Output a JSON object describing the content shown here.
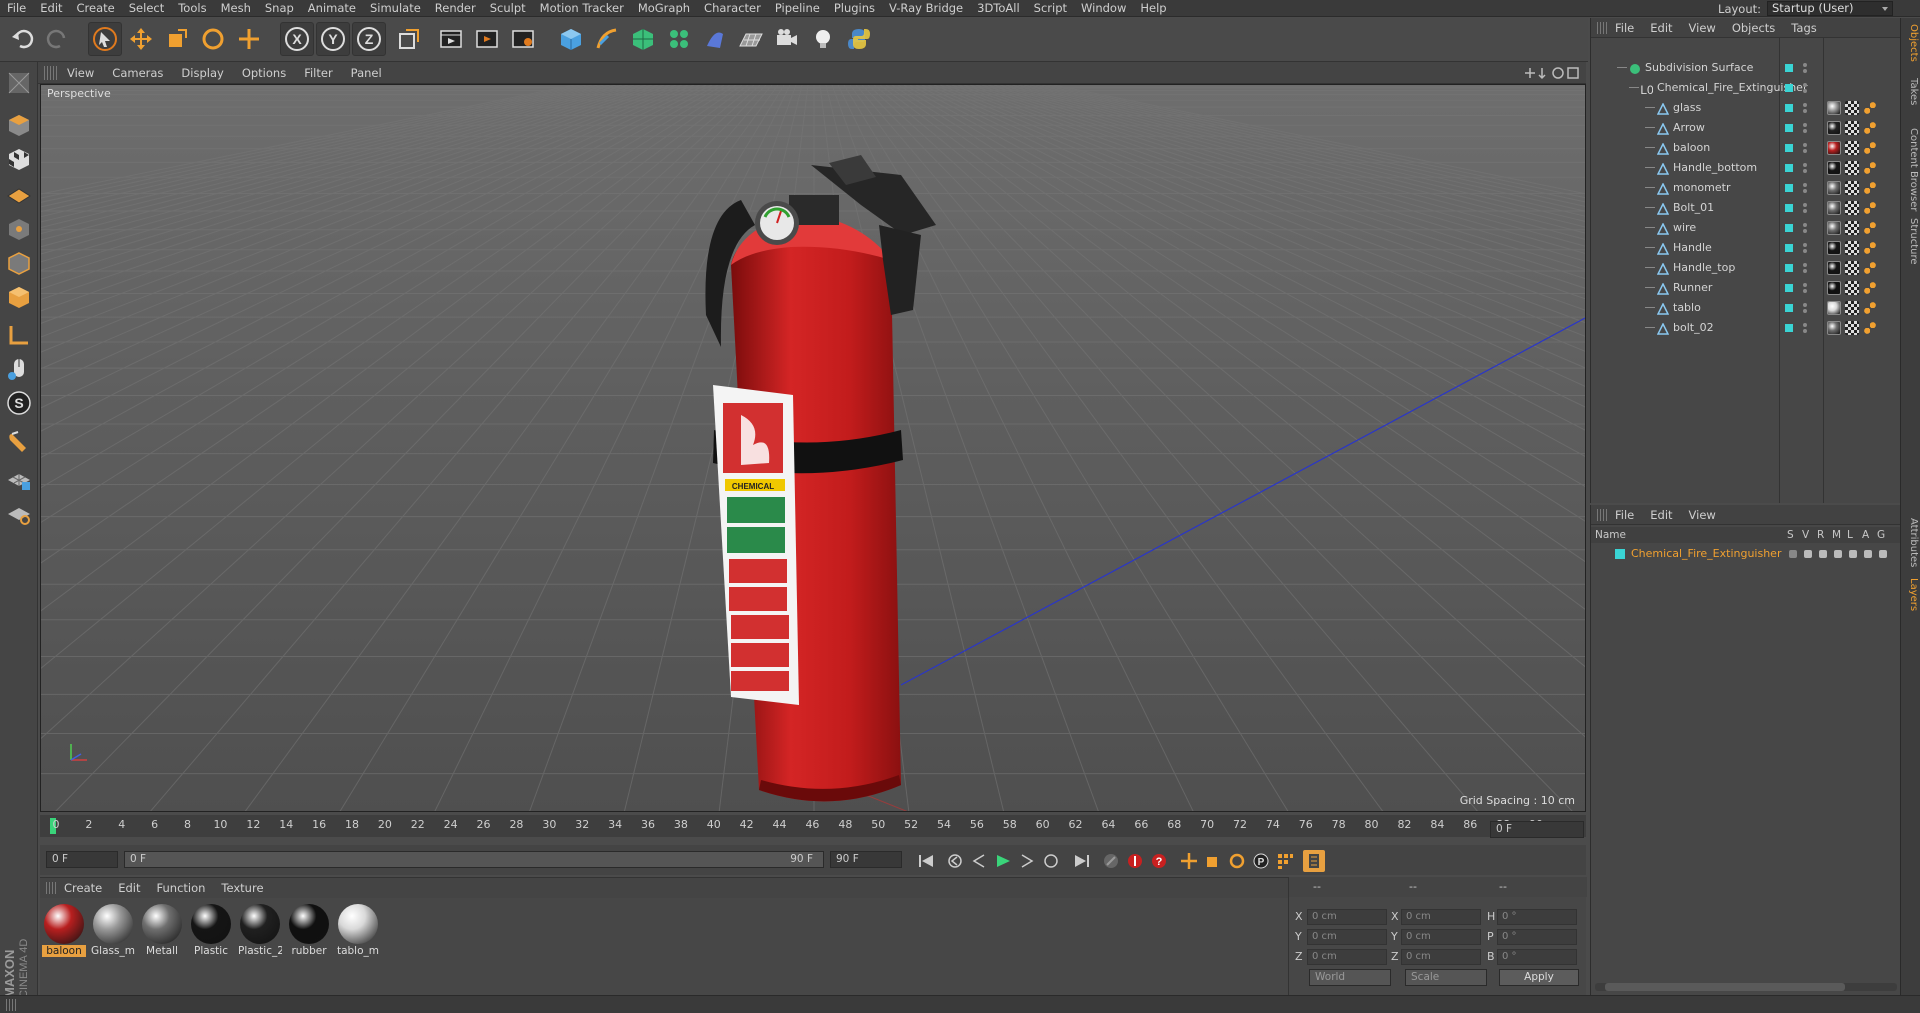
{
  "menu": [
    "File",
    "Edit",
    "Create",
    "Select",
    "Tools",
    "Mesh",
    "Snap",
    "Animate",
    "Simulate",
    "Render",
    "Sculpt",
    "Motion Tracker",
    "MoGraph",
    "Character",
    "Pipeline",
    "Plugins",
    "V-Ray Bridge",
    "3DToAll",
    "Script",
    "Window",
    "Help"
  ],
  "layout": {
    "label": "Layout:",
    "value": "Startup (User)"
  },
  "viewport": {
    "menu": [
      "View",
      "Cameras",
      "Display",
      "Options",
      "Filter",
      "Panel"
    ],
    "label": "Perspective",
    "grid_spacing": "Grid Spacing : 10 cm",
    "label_text": "CHEMICAL"
  },
  "timeline": {
    "ticks": [
      "0",
      "2",
      "4",
      "6",
      "8",
      "10",
      "12",
      "14",
      "16",
      "18",
      "20",
      "22",
      "24",
      "26",
      "28",
      "30",
      "32",
      "34",
      "36",
      "38",
      "40",
      "42",
      "44",
      "46",
      "48",
      "50",
      "52",
      "54",
      "56",
      "58",
      "60",
      "62",
      "64",
      "66",
      "68",
      "70",
      "72",
      "74",
      "76",
      "78",
      "80",
      "82",
      "84",
      "86",
      "88",
      "90"
    ],
    "current_frame": "0 F",
    "start_field": "0 F",
    "range_start": "0 F",
    "range_end": "90 F",
    "end_field": "90 F",
    "end_frame_field": "0 F"
  },
  "materials": {
    "menu": [
      "Create",
      "Edit",
      "Function",
      "Texture"
    ],
    "items": [
      {
        "name": "baloon",
        "color": "#b81f1f",
        "selected": true
      },
      {
        "name": "Glass_m",
        "color": "#9a9a9a",
        "selected": false
      },
      {
        "name": "Metall",
        "color": "#6f6f6f",
        "selected": false
      },
      {
        "name": "Plastic",
        "color": "#151515",
        "selected": false
      },
      {
        "name": "Plastic_2",
        "color": "#202020",
        "selected": false
      },
      {
        "name": "rubber",
        "color": "#101010",
        "selected": false
      },
      {
        "name": "tablo_m",
        "color": "#d9d9d9",
        "selected": false
      }
    ]
  },
  "coords": {
    "headers": [
      "--",
      "--",
      "--"
    ],
    "rows": [
      {
        "a": "X",
        "av": "0 cm",
        "b": "X",
        "bv": "0 cm",
        "c": "H",
        "cv": "0 °"
      },
      {
        "a": "Y",
        "av": "0 cm",
        "b": "Y",
        "bv": "0 cm",
        "c": "P",
        "cv": "0 °"
      },
      {
        "a": "Z",
        "av": "0 cm",
        "b": "Z",
        "bv": "0 cm",
        "c": "B",
        "cv": "0 °"
      }
    ],
    "world": "World",
    "scale": "Scale",
    "apply": "Apply"
  },
  "objects": {
    "menu": [
      "File",
      "Edit",
      "View",
      "Objects",
      "Tags"
    ],
    "root": "Subdivision Surface",
    "group": "Chemical_Fire_Extinguisher",
    "children": [
      "glass",
      "Arrow",
      "baloon",
      "Handle_bottom",
      "monometr",
      "Bolt_01",
      "wire",
      "Handle",
      "Handle_top",
      "Runner",
      "tablo",
      "bolt_02"
    ],
    "child_tag_colors": [
      "#9a9a9a",
      "#222222",
      "#b81f1f",
      "#151515",
      "#6f6f6f",
      "#6f6f6f",
      "#6f6f6f",
      "#151515",
      "#151515",
      "#101010",
      "#d9d9d9",
      "#6f6f6f"
    ]
  },
  "layers": {
    "menu": [
      "File",
      "Edit",
      "View"
    ],
    "columns": {
      "name": "Name",
      "flags": [
        "S",
        "V",
        "R",
        "M",
        "L",
        "A",
        "G"
      ]
    },
    "items": [
      "Chemical_Fire_Extinguisher"
    ]
  },
  "side_tabs": [
    "Objects",
    "Takes",
    "Content Browser",
    "Structure",
    "Attributes",
    "Layers"
  ],
  "brand": [
    "MAXON",
    "CINEMA 4D"
  ]
}
